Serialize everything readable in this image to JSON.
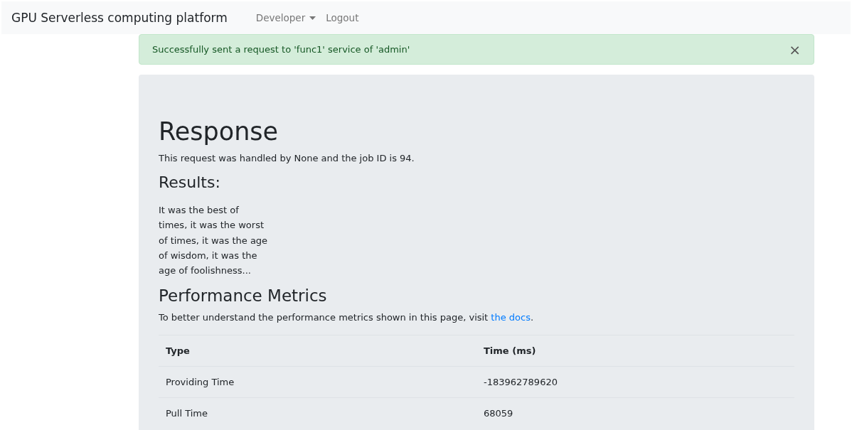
{
  "navbar": {
    "brand": "GPU Serverless computing platform",
    "items": [
      {
        "label": "Developer",
        "kind": "dropdown"
      },
      {
        "label": "Logout",
        "kind": "link"
      }
    ]
  },
  "alert": {
    "message": "Successfully sent a request to 'func1' service of 'admin'",
    "close": "×"
  },
  "response": {
    "title": "Response",
    "handled": "This request was handled by None and the job ID is 94.",
    "results_title": "Results:",
    "results_lines": [
      "It was the best of",
      "times, it was the worst",
      "of times, it was the age",
      "of wisdom, it was the",
      "age of foolishness..."
    ],
    "metrics_title": "Performance Metrics",
    "metrics_text": "To better understand the performance metrics shown in this page, visit",
    "metrics_link": "the docs",
    "metrics_end": ".",
    "table": {
      "columns": [
        "Type",
        "Time (ms)"
      ],
      "rows": [
        [
          "Providing Time",
          "-183962789620"
        ],
        [
          "Pull Time",
          "68059"
        ]
      ]
    }
  }
}
